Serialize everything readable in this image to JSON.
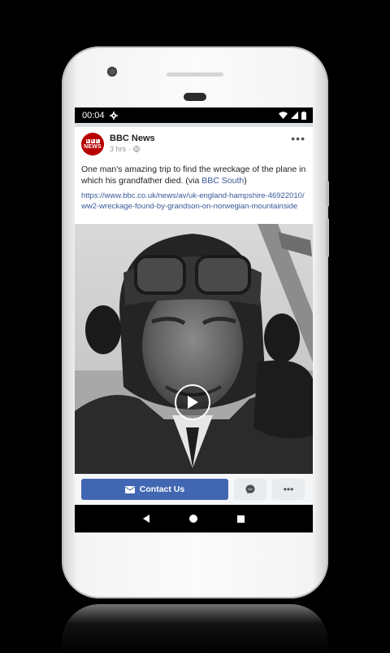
{
  "status_bar": {
    "time": "00:04"
  },
  "post": {
    "page_name": "BBC News",
    "avatar_text": "NEWS",
    "avatar_blocks": [
      "B",
      "B",
      "C"
    ],
    "time_ago": "3 hrs",
    "text": "One man's amazing trip to find the wreckage of the plane in which his grandfather died. (via ",
    "via_link": "BBC South",
    "text_end": ")",
    "url": "https://www.bbc.co.uk/news/av/uk-england-hampshire-46922010/ww2-wreckage-found-by-grandson-on-norwegian-mountainside"
  },
  "actions": {
    "contact_label": "Contact Us"
  },
  "colors": {
    "brand_blue": "#4267b2",
    "link": "#385898",
    "bbc_red": "#b80000"
  },
  "icons": {
    "status_left": [
      "gear-icon"
    ],
    "status_right": [
      "wifi-icon",
      "signal-icon",
      "battery-icon"
    ],
    "header": [
      "globe-icon",
      "more-icon"
    ],
    "media": [
      "play-icon"
    ],
    "actions": [
      "envelope-icon",
      "messenger-icon",
      "more-horizontal-icon"
    ],
    "nav": [
      "back-icon",
      "home-icon",
      "recents-icon"
    ]
  }
}
